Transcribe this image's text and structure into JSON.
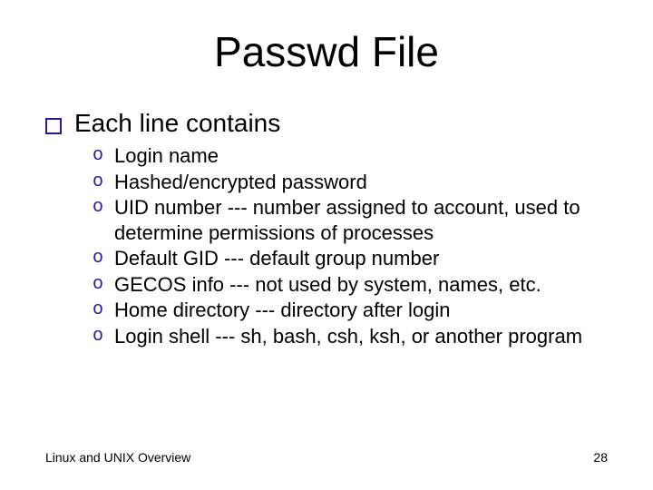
{
  "title": "Passwd File",
  "heading": "Each line contains",
  "items": [
    "Login name",
    "Hashed/encrypted password",
    "UID number --- number assigned to account, used to determine permissions of processes",
    "Default GID --- default group number",
    "GECOS info --- not used by system, names, etc.",
    "Home directory --- directory after login",
    "Login shell --- sh, bash, csh, ksh, or another program"
  ],
  "footer": {
    "left": "Linux and UNIX Overview",
    "page": "28"
  }
}
